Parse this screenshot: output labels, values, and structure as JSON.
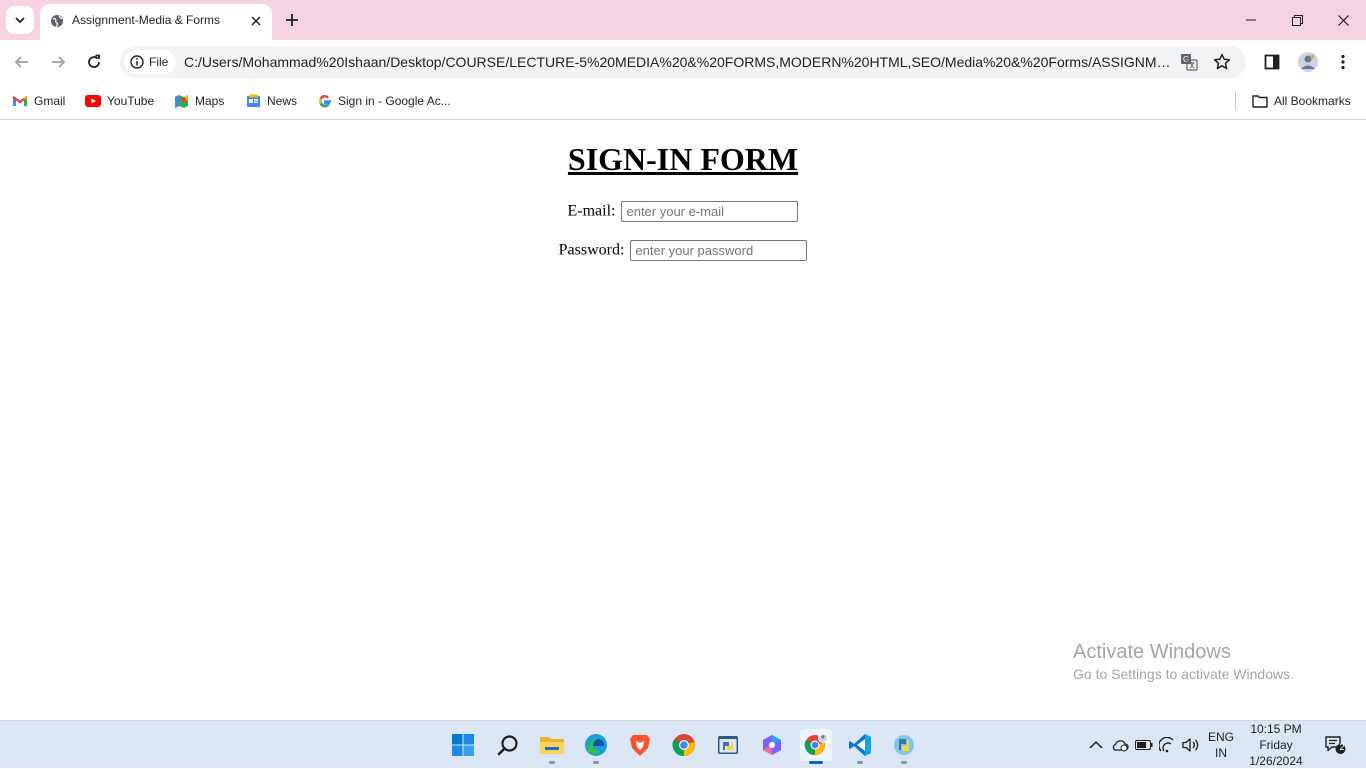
{
  "browser": {
    "tab": {
      "title": "Assignment-Media & Forms"
    },
    "address": {
      "scheme_label": "File",
      "url": "C:/Users/Mohammad%20Ishaan/Desktop/COURSE/LECTURE-5%20MEDIA%20&%20FORMS,MODERN%20HTML,SEO/Media%20&%20Forms/ASSIGNMENT/SO..."
    },
    "bookmarks": [
      {
        "label": "Gmail",
        "icon": "gmail-icon"
      },
      {
        "label": "YouTube",
        "icon": "youtube-icon"
      },
      {
        "label": "Maps",
        "icon": "maps-icon"
      },
      {
        "label": "News",
        "icon": "news-icon"
      },
      {
        "label": "Sign in - Google Ac...",
        "icon": "google-icon"
      }
    ],
    "all_bookmarks_label": "All Bookmarks"
  },
  "page": {
    "title": "SIGN-IN FORM",
    "email": {
      "label": "E-mail:",
      "placeholder": "enter your e-mail"
    },
    "password": {
      "label": "Password:",
      "placeholder": "enter your password"
    }
  },
  "watermark": {
    "title": "Activate Windows",
    "subtitle": "Go to Settings to activate Windows."
  },
  "taskbar": {
    "apps": [
      "start-icon",
      "search-icon",
      "file-explorer-icon",
      "edge-icon",
      "brave-icon",
      "chrome-icon",
      "python-icon",
      "copilot-icon",
      "chrome-profile-icon",
      "vscode-icon",
      "python-idle-icon"
    ],
    "language": {
      "line1": "ENG",
      "line2": "IN"
    },
    "clock": {
      "time": "10:15 PM",
      "day": "Friday",
      "date": "1/26/2024"
    },
    "notification_count": "2"
  },
  "colors": {
    "tabstrip": "#f6d3e2",
    "omnibox": "#f1f3f4",
    "taskbar": "#dce7f5",
    "accent": "#0067c0"
  }
}
